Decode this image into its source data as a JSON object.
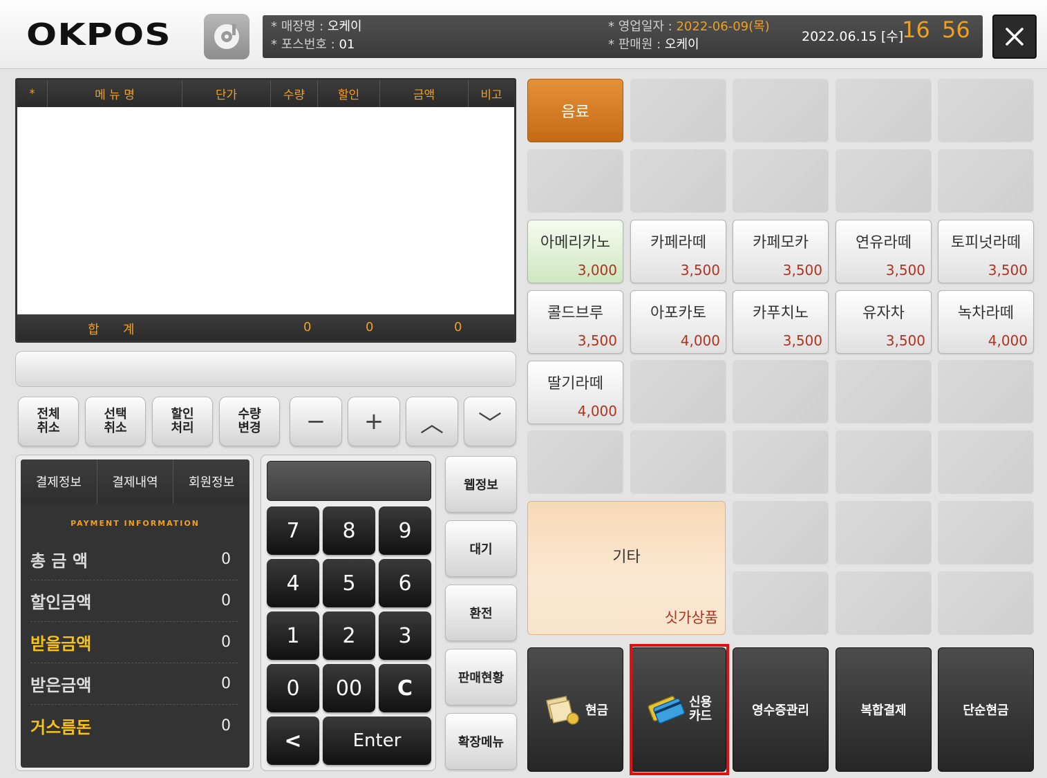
{
  "header": {
    "logo_text": "OKPOS",
    "store_label": "* 매장명 :",
    "store_value": "오케이",
    "pos_label": "* 포스번호 :",
    "pos_value": "01",
    "bizdate_label": "* 영업일자 :",
    "bizdate_value": "2022-06-09(목)",
    "cashier_label": "* 판매원 :",
    "cashier_value": "오케이",
    "date_now": "2022.06.15 [수]",
    "hour": "16",
    "minute": "56",
    "close_symbol": "✕"
  },
  "order_table": {
    "columns": [
      "*",
      "메 뉴 명",
      "단가",
      "수량",
      "할인",
      "금액",
      "비고"
    ],
    "rows": [],
    "footer_label": "합      계",
    "footer_qty": "0",
    "footer_discount": "0",
    "footer_amount": "0"
  },
  "actions": {
    "cancel_all": "전체\n취소",
    "cancel_selected": "선택\n취소",
    "discount": "할인\n처리",
    "qty_change": "수량\n변경",
    "minus": "−",
    "plus": "+",
    "up": "︿",
    "down": "﹀"
  },
  "payment": {
    "tabs": [
      "결제정보",
      "결제내역",
      "회원정보"
    ],
    "subtitle": "PAYMENT INFORMATION",
    "rows": [
      {
        "label": "총 금 액",
        "value": "0"
      },
      {
        "label": "할인금액",
        "value": "0"
      },
      {
        "label": "받을금액",
        "value": "0"
      },
      {
        "label": "받은금액",
        "value": "0"
      },
      {
        "label": "거스름돈",
        "value": "0"
      }
    ]
  },
  "keypad": {
    "keys": [
      "7",
      "8",
      "9",
      "4",
      "5",
      "6",
      "1",
      "2",
      "3",
      "0",
      "00",
      "C"
    ],
    "back": "<",
    "enter": "Enter"
  },
  "side_keys": [
    "웹정보",
    "대기",
    "환전",
    "판매현황",
    "확장메뉴"
  ],
  "categories": {
    "drink": "음료"
  },
  "products": [
    {
      "name": "아메리카노",
      "price": "3,000"
    },
    {
      "name": "카페라떼",
      "price": "3,500"
    },
    {
      "name": "카페모카",
      "price": "3,500"
    },
    {
      "name": "연유라떼",
      "price": "3,500"
    },
    {
      "name": "토피넛라떼",
      "price": "3,500"
    },
    {
      "name": "콜드브루",
      "price": "3,500"
    },
    {
      "name": "아포카토",
      "price": "4,000"
    },
    {
      "name": "카푸치노",
      "price": "3,500"
    },
    {
      "name": "유자차",
      "price": "3,500"
    },
    {
      "name": "녹차라떼",
      "price": "4,000"
    },
    {
      "name": "딸기라떼",
      "price": "4,000"
    }
  ],
  "etc": {
    "label": "기타",
    "sub": "싯가상품"
  },
  "pay_buttons": {
    "cash": "현금",
    "credit_card": "신용\n카드",
    "receipt": "영수증관리",
    "combined": "복합결제",
    "simple_cash": "단순현금"
  },
  "colors": {
    "accent_orange": "#f0a020",
    "price_red": "#b1321e",
    "highlight_red": "#e01010"
  }
}
